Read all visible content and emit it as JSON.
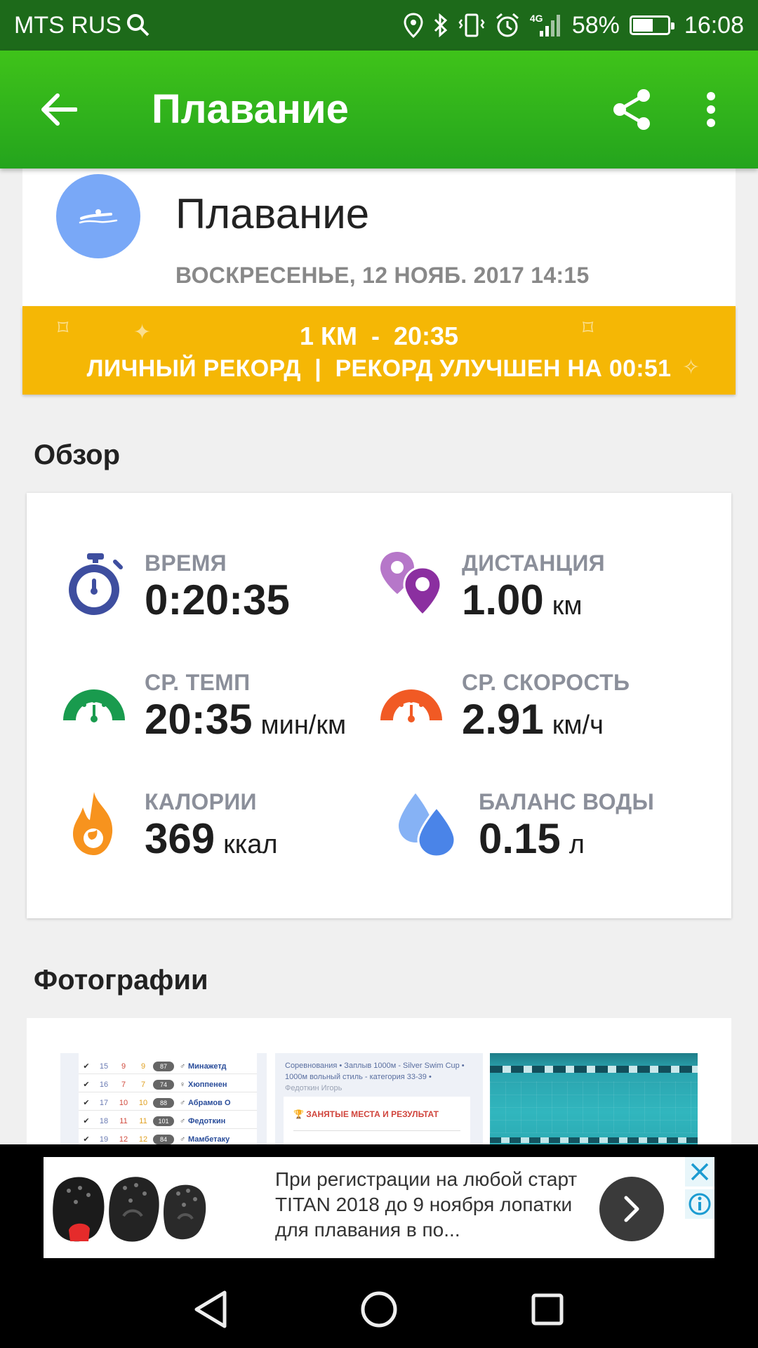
{
  "status_bar": {
    "carrier": "MTS RUS",
    "network": "4G",
    "battery": "58%",
    "battery_level": 0.58,
    "time": "16:08"
  },
  "app_bar": {
    "title": "Плавание"
  },
  "activity": {
    "name": "Плавание",
    "date": "ВОСКРЕСЕНЬЕ, 12 НОЯБ. 2017 14:15"
  },
  "record": {
    "headline": "1 КМ  -  20:35",
    "detail": "ЛИЧНЫЙ РЕКОРД  |  РЕКОРД УЛУЧШЕН НА 00:51"
  },
  "overview": {
    "title": "Обзор",
    "stats": {
      "time": {
        "label": "ВРЕМЯ",
        "value": "0:20:35",
        "unit": "",
        "icon": "stopwatch-icon"
      },
      "distance": {
        "label": "ДИСТАНЦИЯ",
        "value": "1.00",
        "unit": "км",
        "icon": "map-pin-icon"
      },
      "pace": {
        "label": "СР. ТЕМП",
        "value": "20:35",
        "unit": "мин/км",
        "icon": "pace-gauge-icon"
      },
      "speed": {
        "label": "СР. СКОРОСТЬ",
        "value": "2.91",
        "unit": "км/ч",
        "icon": "speed-gauge-icon"
      },
      "calories": {
        "label": "КАЛОРИИ",
        "value": "369",
        "unit": "ккал",
        "icon": "flame-icon"
      },
      "water": {
        "label": "БАЛАНС ВОДЫ",
        "value": "0.15",
        "unit": "л",
        "icon": "water-drops-icon"
      }
    }
  },
  "photos": {
    "title": "Фотографии",
    "table_rows": [
      [
        "15",
        "9",
        "9",
        "87",
        "♂",
        "Минажетд"
      ],
      [
        "16",
        "7",
        "7",
        "74",
        "♀",
        "Хюппенен"
      ],
      [
        "17",
        "10",
        "10",
        "88",
        "♂",
        "Абрамов О"
      ],
      [
        "18",
        "11",
        "11",
        "101",
        "♂",
        "Федоткин"
      ],
      [
        "19",
        "12",
        "12",
        "84",
        "♂",
        "Мамбетаку"
      ]
    ],
    "doc_breadcrumb": "Соревнования  •  Заплыв 1000м - Silver Swim Cup  •  1000м вольный стиль - категория 33-39  •",
    "doc_person": "Федоткин Игорь",
    "doc_section": "ЗАНЯТЫЕ МЕСТА И РЕЗУЛЬТАТ"
  },
  "ad": {
    "text": "При регистрации на любой старт TITAN 2018 до 9 ноября лопатки для плавания в по..."
  },
  "colors": {
    "app_bar": "#2fb31c",
    "status_bar": "#1d6a1a",
    "record_banner": "#f5b705",
    "avatar": "#79a8f7"
  }
}
